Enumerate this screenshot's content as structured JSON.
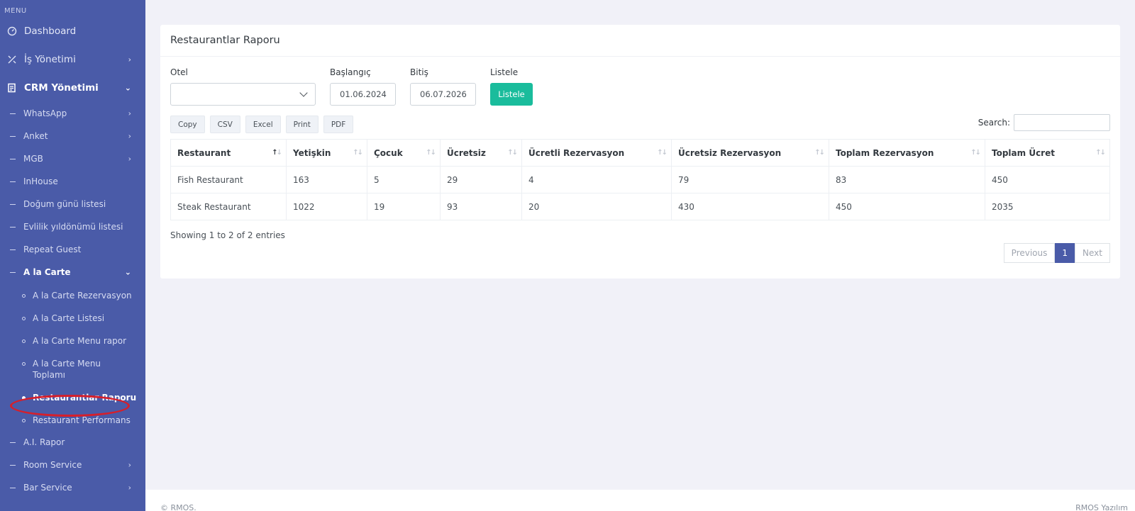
{
  "sidebar": {
    "menu_title": "MENU",
    "top_items": [
      {
        "label": "Dashboard",
        "icon": "gauge-icon"
      },
      {
        "label": "İş Yönetimi",
        "icon": "tools-icon"
      },
      {
        "label": "CRM Yönetimi",
        "icon": "document-icon"
      }
    ],
    "crm_items": [
      {
        "label": "WhatsApp"
      },
      {
        "label": "Anket"
      },
      {
        "label": "MGB"
      },
      {
        "label": "InHouse"
      },
      {
        "label": "Doğum günü listesi"
      },
      {
        "label": "Evlilik yıldönümü listesi"
      },
      {
        "label": "Repeat Guest"
      },
      {
        "label": "A la Carte"
      }
    ],
    "alacarte_items": [
      {
        "label": "A la Carte Rezervasyon"
      },
      {
        "label": "A la Carte Listesi"
      },
      {
        "label": "A la Carte Menu rapor"
      },
      {
        "label": "A la Carte Menu Toplamı"
      },
      {
        "label": "Restaurantlar Raporu"
      },
      {
        "label": "Restaurant Performans"
      }
    ],
    "after_items": [
      {
        "label": "A.I. Rapor"
      },
      {
        "label": "Room Service"
      },
      {
        "label": "Bar Service"
      }
    ],
    "highlight_color": "#d61f2b"
  },
  "page": {
    "title": "Restaurantlar Raporu",
    "filters": {
      "hotel_label": "Otel",
      "hotel_value": "",
      "start_label": "Başlangıç",
      "start_value": "01.06.2024",
      "end_label": "Bitiş",
      "end_value": "06.07.2026",
      "list_label": "Listele",
      "list_button": "Listele"
    },
    "exports": [
      "Copy",
      "CSV",
      "Excel",
      "Print",
      "PDF"
    ],
    "search_label": "Search:",
    "search_value": "",
    "table": {
      "columns": [
        "Restaurant",
        "Yetişkin",
        "Çocuk",
        "Ücretsiz",
        "Ücretli Rezervasyon",
        "Ücretsiz Rezervasyon",
        "Toplam Rezervasyon",
        "Toplam Ücret"
      ],
      "rows": [
        [
          "Fish Restaurant",
          "163",
          "5",
          "29",
          "4",
          "79",
          "83",
          "450"
        ],
        [
          "Steak Restaurant",
          "1022",
          "19",
          "93",
          "20",
          "430",
          "450",
          "2035"
        ]
      ]
    },
    "info": "Showing 1 to 2 of 2 entries",
    "pager": {
      "previous": "Previous",
      "current": "1",
      "next": "Next"
    }
  },
  "footer": {
    "left": "© RMOS.",
    "right": "RMOS Yazılım"
  },
  "colors": {
    "sidebar": "#4a5ba8",
    "accent": "#1abc9c"
  }
}
